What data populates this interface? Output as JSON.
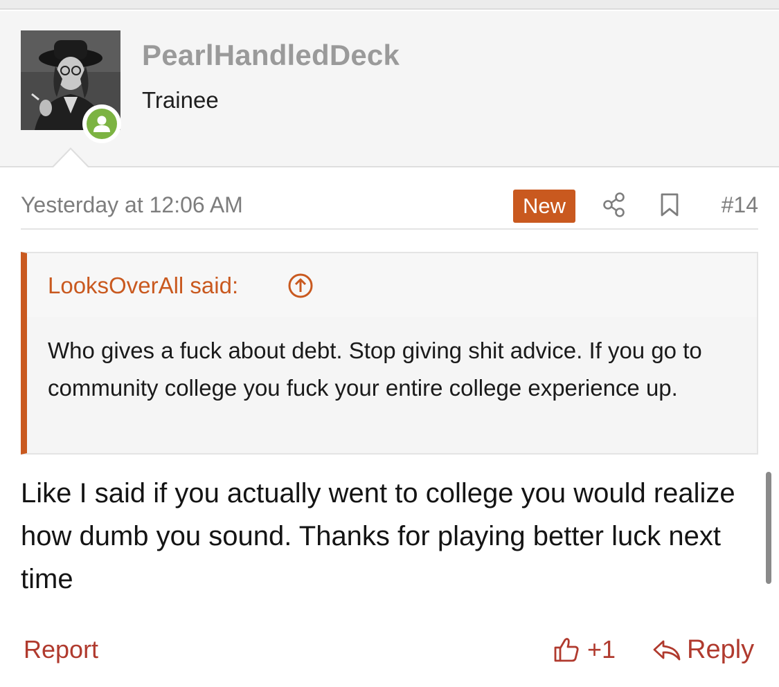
{
  "user": {
    "username": "PearlHandledDeck",
    "title": "Trainee",
    "avatar_icon": "user-avatar-photo",
    "status_icon": "online-user-icon",
    "status_color": "#7cb342"
  },
  "post": {
    "date": "Yesterday at 12:06 AM",
    "new_badge": "New",
    "number": "#14",
    "share_icon": "share-icon",
    "bookmark_icon": "bookmark-icon"
  },
  "quote": {
    "author": "LooksOverAll said:",
    "jump_icon": "arrow-up-circle-icon",
    "text": "Who gives a fuck about debt. Stop giving shit advice. If you go to community college you fuck your entire college experience up."
  },
  "message": {
    "text": "Like I said if you actually went to college you would realize how dumb you sound. Thanks for playing better luck next time"
  },
  "actions": {
    "report": "Report",
    "like_count": "+1",
    "reply": "Reply"
  },
  "colors": {
    "accent": "#c9591f",
    "action": "#b03a2e"
  }
}
